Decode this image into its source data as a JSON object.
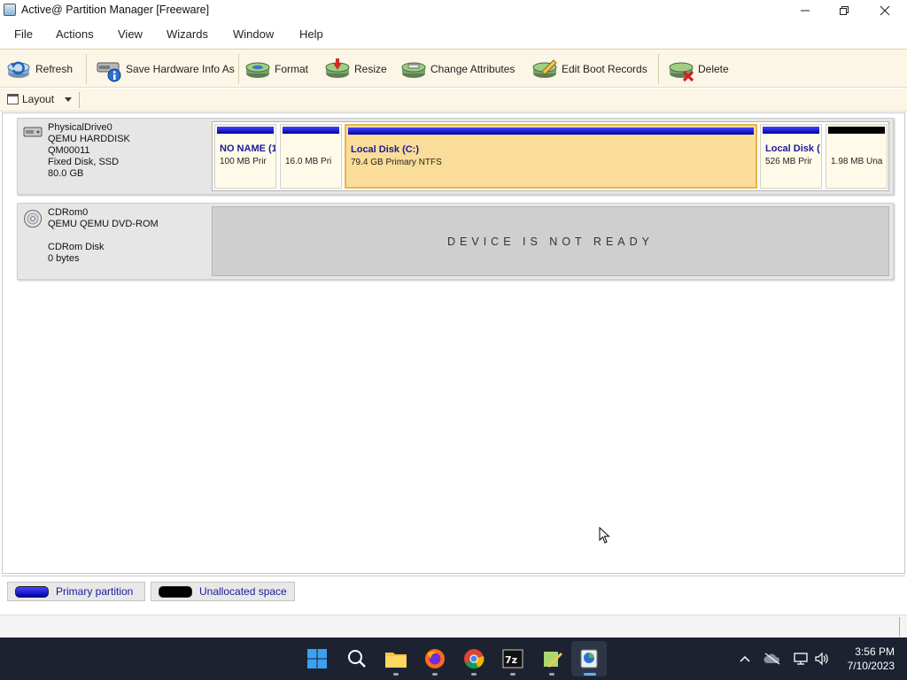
{
  "window": {
    "title": "Active@ Partition Manager [Freeware]"
  },
  "menu": [
    "File",
    "Actions",
    "View",
    "Wizards",
    "Window",
    "Help"
  ],
  "toolbar": {
    "refresh": "Refresh",
    "save_hw": "Save Hardware Info As",
    "format": "Format",
    "resize": "Resize",
    "change_attr": "Change Attributes",
    "edit_boot": "Edit Boot Records",
    "delete": "Delete"
  },
  "layout_bar": {
    "label": "Layout"
  },
  "disks": [
    {
      "name": "PhysicalDrive0",
      "model": "QEMU HARDDISK",
      "serial": "QM00011",
      "type": "Fixed Disk, SSD",
      "size": "80.0 GB",
      "partitions": [
        {
          "name": "NO NAME (1",
          "desc": "100 MB Prir"
        },
        {
          "name": "",
          "desc": "16.0 MB Pri"
        },
        {
          "name": "Local Disk (C:)",
          "desc": "79.4 GB Primary NTFS"
        },
        {
          "name": "Local Disk (",
          "desc": "526 MB Prir"
        },
        {
          "name": "",
          "desc": "1.98 MB Una"
        }
      ]
    },
    {
      "name": "CDRom0",
      "model": "QEMU QEMU DVD-ROM",
      "type": "CDRom Disk",
      "size": "0 bytes",
      "status": "DEVICE IS NOT READY"
    }
  ],
  "legend": {
    "primary": "Primary partition",
    "unallocated": "Unallocated space"
  },
  "colors": {
    "primary": "#1010c8",
    "unallocated": "#000000",
    "selected": "#fbdd9a",
    "taskbar": "#1c2230"
  },
  "taskbar": {
    "apps": [
      "start-icon",
      "search-icon",
      "file-explorer-icon",
      "firefox-icon",
      "chrome-icon",
      "7zip-icon",
      "notepadpp-icon",
      "partition-manager-icon"
    ],
    "time": "3:56 PM",
    "date": "7/10/2023"
  }
}
